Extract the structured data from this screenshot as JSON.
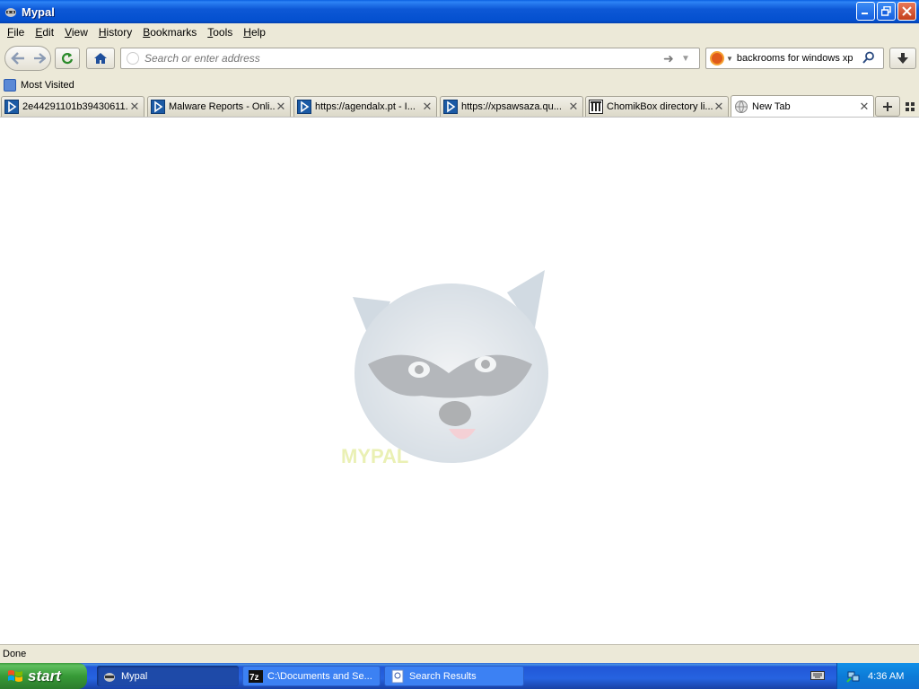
{
  "window": {
    "title": "Mypal"
  },
  "menu": [
    {
      "label": "File",
      "key": "F",
      "rest": "ile"
    },
    {
      "label": "Edit",
      "key": "E",
      "rest": "dit"
    },
    {
      "label": "View",
      "key": "V",
      "rest": "iew"
    },
    {
      "label": "History",
      "key": "H",
      "rest": "istory"
    },
    {
      "label": "Bookmarks",
      "key": "B",
      "rest": "ookmarks"
    },
    {
      "label": "Tools",
      "key": "T",
      "rest": "ools"
    },
    {
      "label": "Help",
      "key": "H",
      "rest": "elp"
    }
  ],
  "navbar": {
    "url_placeholder": "Search or enter address",
    "search_value": "backrooms for windows xp"
  },
  "bookmarks": {
    "most_visited": "Most Visited"
  },
  "tabs": [
    {
      "label": "2e44291101b39430611...",
      "icon": "play-icon"
    },
    {
      "label": "Malware Reports - Onli...",
      "icon": "play-icon"
    },
    {
      "label": "https://agendalx.pt - I...",
      "icon": "play-icon"
    },
    {
      "label": "https://xpsawsaza.qu...",
      "icon": "play-icon"
    },
    {
      "label": "ChomikBox directory li...",
      "icon": "building-icon"
    },
    {
      "label": "New Tab",
      "icon": "globe-icon",
      "active": true
    }
  ],
  "content": {
    "logo_text": "MYPAL"
  },
  "status": {
    "text": "Done"
  },
  "taskbar": {
    "start_label": "start",
    "items": [
      {
        "label": "Mypal",
        "active": true
      },
      {
        "label": "C:\\Documents and Se...",
        "active": false
      },
      {
        "label": "Search Results",
        "active": false
      }
    ],
    "clock": "4:36 AM"
  },
  "colors": {
    "titlebar": "#0450cf",
    "taskbar": "#2663e0",
    "start": "#379a37",
    "chrome": "#ece9d8"
  }
}
